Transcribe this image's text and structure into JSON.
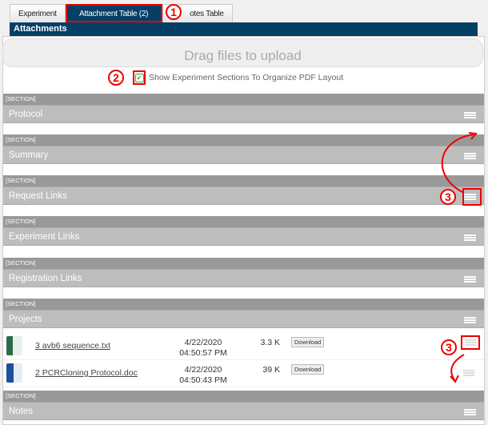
{
  "tabs": [
    {
      "label": "Experiment"
    },
    {
      "label": "Attachment Table (2)"
    },
    {
      "label": "Notes Table"
    }
  ],
  "tab3_visible": "otes Table",
  "header": "Attachments",
  "drop_label": "Drag files to upload",
  "checkbox": {
    "label": "Show Experiment Sections To Organize PDF Layout",
    "checked": true
  },
  "section_tag": "[SECTION]",
  "sections": [
    {
      "title": "Protocol"
    },
    {
      "title": "Summary"
    },
    {
      "title": "Request Links"
    },
    {
      "title": "Experiment Links"
    },
    {
      "title": "Registration Links"
    },
    {
      "title": "Projects"
    },
    {
      "title": "Notes"
    }
  ],
  "files": [
    {
      "name": "3 avb6 sequence.txt",
      "date": "4/22/2020",
      "time": "04:50:57 PM",
      "size": "3.3 K",
      "action": "Download",
      "icon": "text-file-icon"
    },
    {
      "name": "2 PCRCloning Protocol.doc",
      "date": "4/22/2020",
      "time": "04:50:43 PM",
      "size": "39 K",
      "action": "Download",
      "icon": "word-file-icon"
    }
  ],
  "annotations": [
    "1",
    "2",
    "3",
    "3"
  ],
  "colors": {
    "header": "#053f66",
    "annotation": "#e00000"
  }
}
